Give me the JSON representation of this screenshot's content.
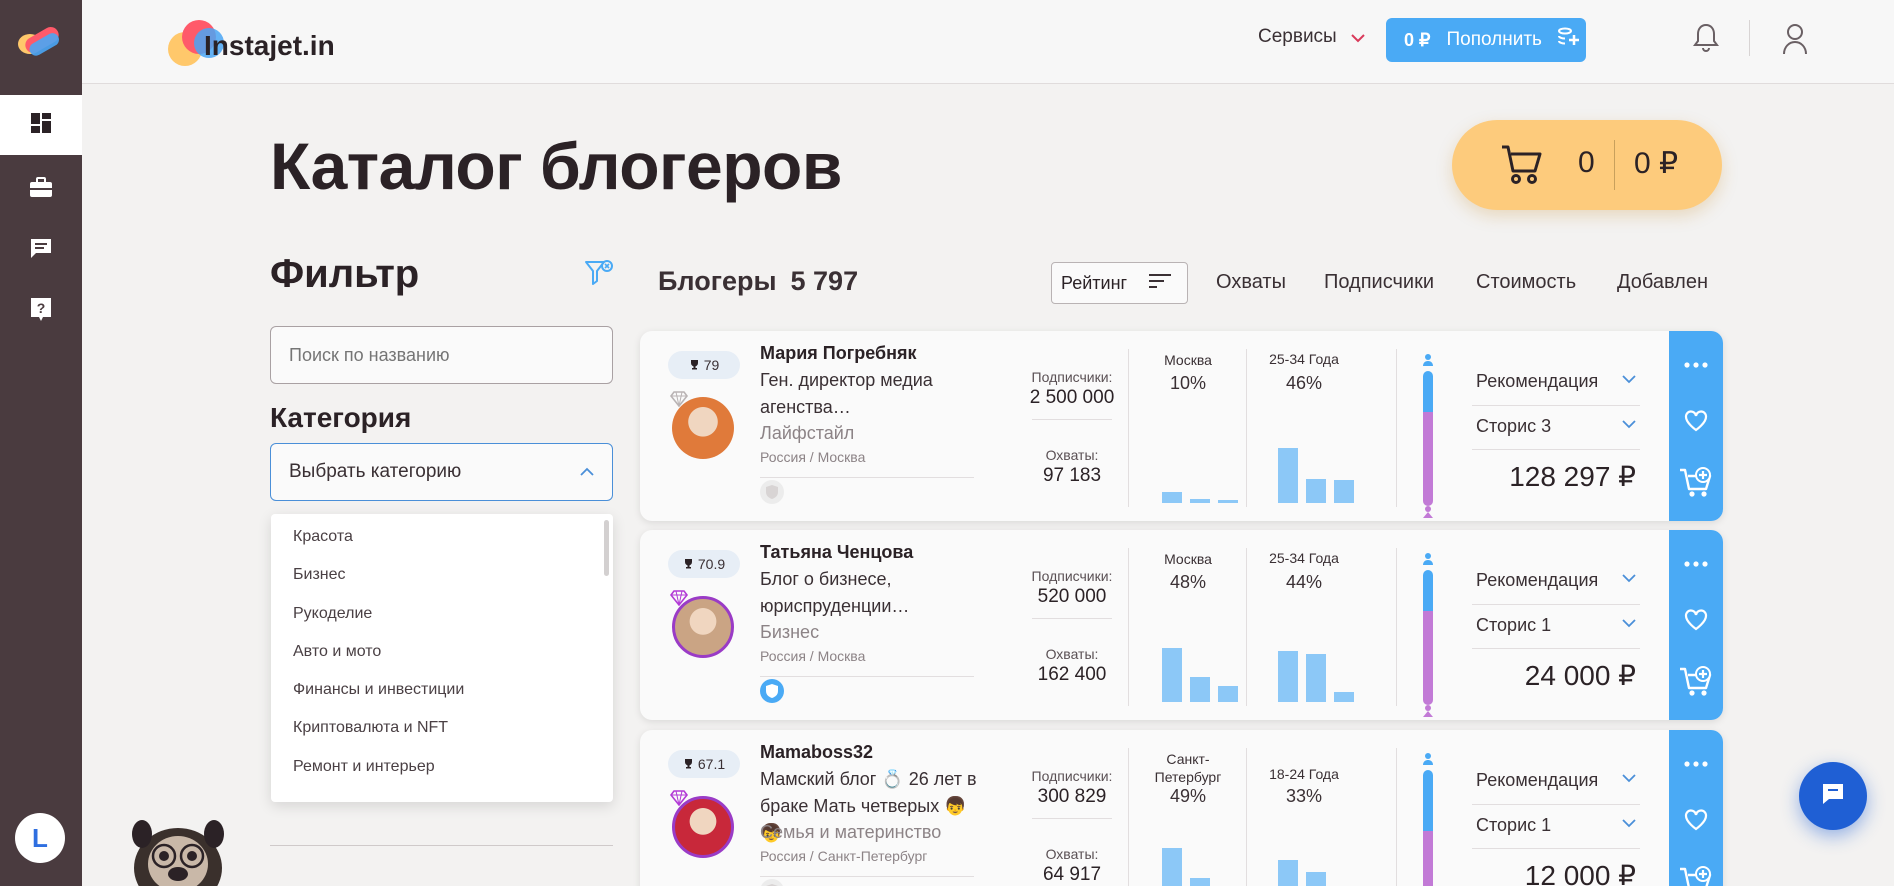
{
  "brand": {
    "name": "Instajet.in"
  },
  "header": {
    "services_label": "Сервисы",
    "balance": "0 ₽",
    "topup_label": "Пополнить"
  },
  "sidebar": {
    "user_initial": "L"
  },
  "page": {
    "title": "Каталог блогеров"
  },
  "cart": {
    "count": "0",
    "sum": "0 ₽"
  },
  "filter": {
    "title": "Фильтр",
    "search_placeholder": "Поиск по названию",
    "category_title": "Категория",
    "category_select": "Выбрать категорию",
    "category_options": [
      "Красота",
      "Бизнес",
      "Рукоделие",
      "Авто и мото",
      "Финансы и инвестиции",
      "Криптовалюта и NFT",
      "Ремонт и интерьер"
    ]
  },
  "bloggers": {
    "title": "Блогеры",
    "count": "5 797",
    "sort": {
      "rating": "Рейтинг",
      "reach": "Охваты",
      "subscribers": "Подписчики",
      "cost": "Стоимость",
      "added": "Добавлен"
    },
    "labels": {
      "subscribers": "Подписчики:",
      "reach": "Охваты:"
    },
    "items": [
      {
        "rating": "79",
        "name": "Мария Погребняк",
        "desc": "Ген. директор медиа агенства…",
        "category": "Лайфстайл",
        "location": "Россия / Москва",
        "subscribers": "2 500 000",
        "reach": "97 183",
        "geo_city": "Москва",
        "geo_pct": "10%",
        "geo_bars": [
          0.18,
          0.06,
          0.05
        ],
        "age_group": "25-34 Года",
        "age_pct": "46%",
        "age_bars": [
          0.92,
          0.4,
          0.38
        ],
        "male_share": 0.3,
        "rec_label": "Рекомендация",
        "format_label": "Сторис 3",
        "price": "128 297 ₽",
        "photo_color": "#e07a3a",
        "premium": false,
        "verified": false
      },
      {
        "rating": "70.9",
        "name": "Татьяна Ченцова",
        "desc": "Блог о бизнесе, юриспруденции…",
        "category": "Бизнес",
        "location": "Россия / Москва",
        "subscribers": "520 000",
        "reach": "162 400",
        "geo_city": "Москва",
        "geo_pct": "48%",
        "geo_bars": [
          0.9,
          0.42,
          0.26
        ],
        "age_group": "25-34 Года",
        "age_pct": "44%",
        "age_bars": [
          0.85,
          0.8,
          0.16
        ],
        "male_share": 0.3,
        "rec_label": "Рекомендация",
        "format_label": "Сторис 1",
        "price": "24 000 ₽",
        "photo_color": "#caa484",
        "premium": true,
        "verified": true
      },
      {
        "rating": "67.1",
        "name": "Mamaboss32",
        "desc": "Мамский блог 💍 26 лет в браке Мать четверых 👦 👦",
        "category": "Семья и материнство",
        "location": "Россия / Санкт-Петербург",
        "subscribers": "300 829",
        "reach": "64 917",
        "geo_city": "Санкт-Петербург",
        "geo_pct": "49%",
        "geo_bars": [
          0.9,
          0.4,
          0.2
        ],
        "age_group": "18-24 Года",
        "age_pct": "33%",
        "age_bars": [
          0.7,
          0.5,
          0.2
        ],
        "male_share": 0.45,
        "rec_label": "Рекомендация",
        "format_label": "Сторис 1",
        "price": "12 000 ₽",
        "photo_color": "#c8283a",
        "premium": true,
        "verified": false
      }
    ]
  },
  "colors": {
    "accent": "#4aaaf5",
    "sidebar": "#4a3b3f",
    "cart": "#fdcb7c",
    "chat": "#1f5fd4"
  },
  "icons": [
    "dashboard-icon",
    "briefcase-icon",
    "chat-icon",
    "help-icon",
    "bell-icon",
    "user-icon",
    "cart-icon",
    "filter-reset-icon",
    "sort-icon",
    "more-icon",
    "heart-icon",
    "add-to-cart-icon",
    "trophy-icon",
    "diamond-icon",
    "verified-icon",
    "chevron-down-icon"
  ]
}
